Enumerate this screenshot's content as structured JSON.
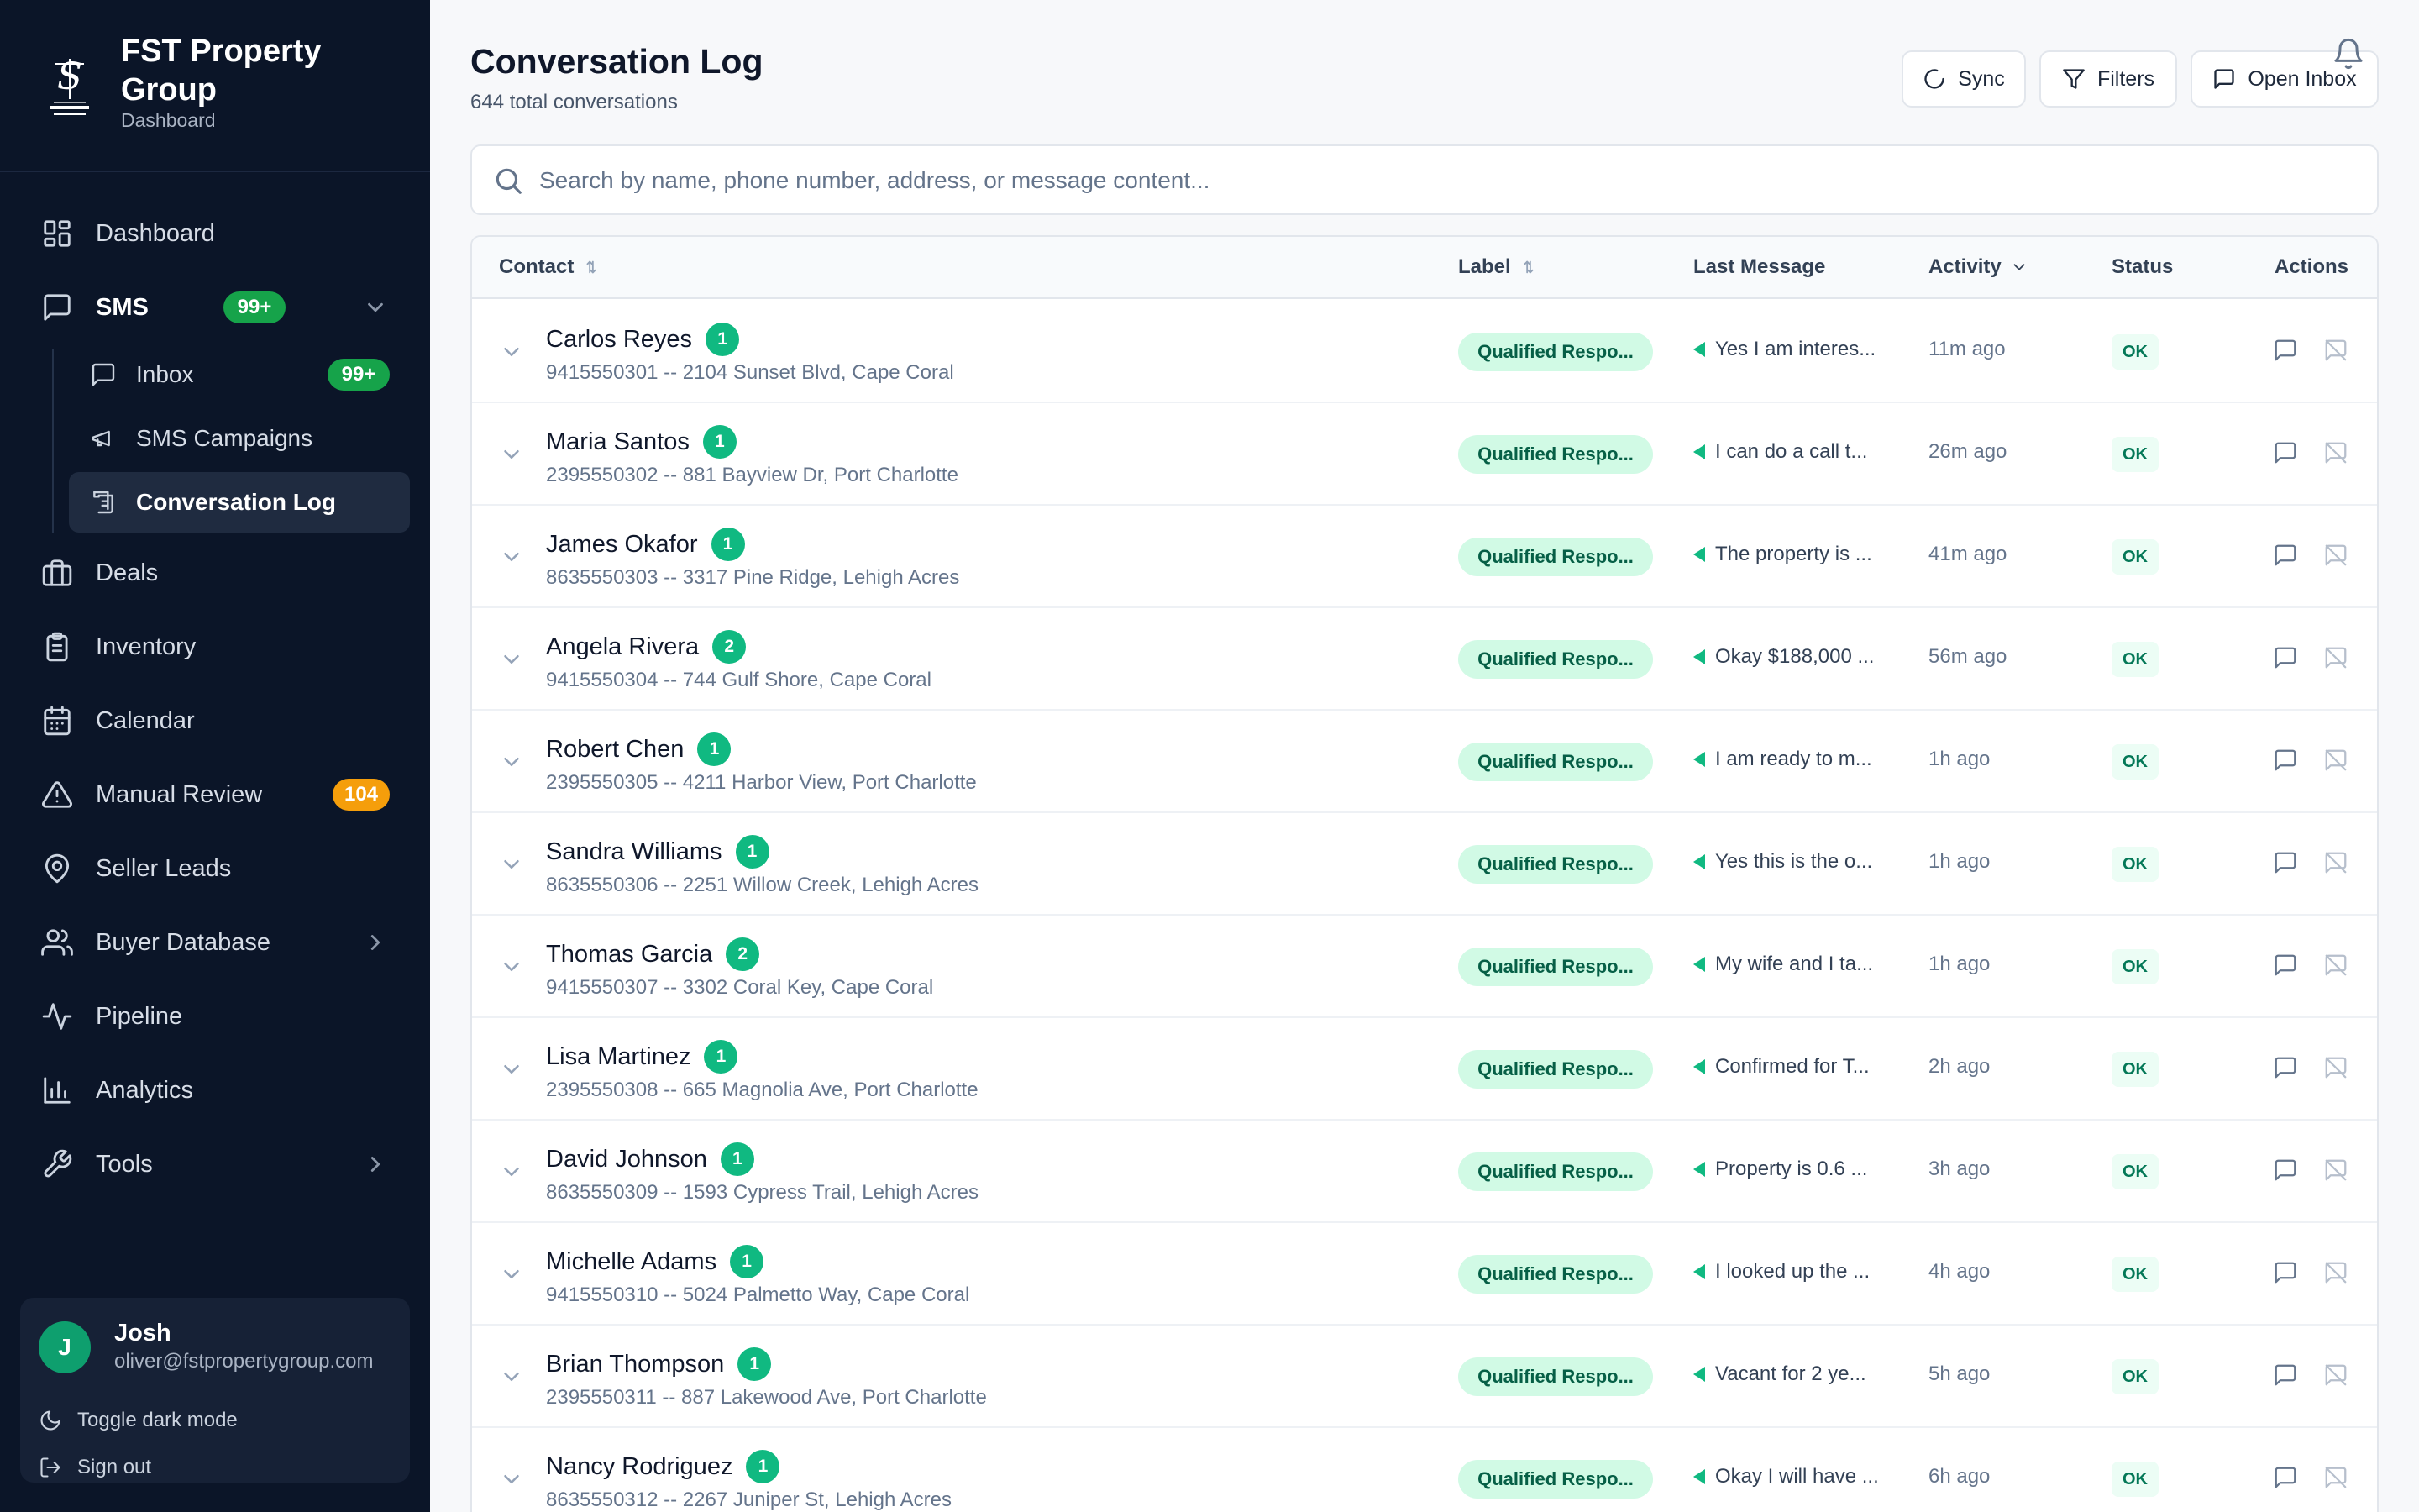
{
  "brand": {
    "name": "FST Property Group",
    "subtitle": "Dashboard"
  },
  "nav": [
    {
      "id": "dashboard",
      "label": "Dashboard",
      "icon": "grid-icon"
    },
    {
      "id": "sms",
      "label": "SMS",
      "icon": "message-square-icon",
      "badge": "99+"
    },
    {
      "id": "deals",
      "label": "Deals",
      "icon": "briefcase-icon"
    },
    {
      "id": "inventory",
      "label": "Inventory",
      "icon": "clipboard-icon"
    },
    {
      "id": "calendar",
      "label": "Calendar",
      "icon": "calendar-icon"
    },
    {
      "id": "manual-review",
      "label": "Manual Review",
      "icon": "alert-triangle-icon",
      "badge": "104"
    },
    {
      "id": "seller-leads",
      "label": "Seller Leads",
      "icon": "map-pin-icon"
    },
    {
      "id": "buyer-database",
      "label": "Buyer Database",
      "icon": "users-icon"
    },
    {
      "id": "pipeline",
      "label": "Pipeline",
      "icon": "activity-icon"
    },
    {
      "id": "analytics",
      "label": "Analytics",
      "icon": "bar-chart-icon"
    },
    {
      "id": "tools",
      "label": "Tools",
      "icon": "wrench-icon"
    }
  ],
  "sms_sub": [
    {
      "label": "Inbox",
      "icon": "message-icon",
      "badge": "99+"
    },
    {
      "label": "SMS Campaigns",
      "icon": "megaphone-icon"
    },
    {
      "label": "Conversation Log",
      "icon": "scroll-icon",
      "active": true
    }
  ],
  "user": {
    "initial": "J",
    "name": "Josh",
    "email": "oliver@fstpropertygroup.com",
    "dark_mode_label": "Toggle dark mode",
    "sign_out_label": "Sign out"
  },
  "header": {
    "title": "Conversation Log",
    "subtitle": "644 total conversations",
    "sync_label": "Sync",
    "filters_label": "Filters",
    "open_inbox_label": "Open Inbox"
  },
  "search": {
    "placeholder": "Search by name, phone number, address, or message content..."
  },
  "table": {
    "columns": {
      "contact": "Contact",
      "label": "Label",
      "last_message": "Last Message",
      "activity": "Activity",
      "status": "Status",
      "actions": "Actions"
    },
    "rows": [
      {
        "name": "Carlos Reyes",
        "count": "1",
        "meta": "9415550301 -- 2104 Sunset Blvd, Cape Coral",
        "label": "Qualified Respo...",
        "message": "Yes I am interes...",
        "activity": "11m ago",
        "status": "OK"
      },
      {
        "name": "Maria Santos",
        "count": "1",
        "meta": "2395550302 -- 881 Bayview Dr, Port Charlotte",
        "label": "Qualified Respo...",
        "message": "I can do a call t...",
        "activity": "26m ago",
        "status": "OK"
      },
      {
        "name": "James Okafor",
        "count": "1",
        "meta": "8635550303 -- 3317 Pine Ridge, Lehigh Acres",
        "label": "Qualified Respo...",
        "message": "The property is ...",
        "activity": "41m ago",
        "status": "OK"
      },
      {
        "name": "Angela Rivera",
        "count": "2",
        "meta": "9415550304 -- 744 Gulf Shore, Cape Coral",
        "label": "Qualified Respo...",
        "message": "Okay $188,000 ...",
        "activity": "56m ago",
        "status": "OK"
      },
      {
        "name": "Robert Chen",
        "count": "1",
        "meta": "2395550305 -- 4211 Harbor View, Port Charlotte",
        "label": "Qualified Respo...",
        "message": "I am ready to m...",
        "activity": "1h ago",
        "status": "OK"
      },
      {
        "name": "Sandra Williams",
        "count": "1",
        "meta": "8635550306 -- 2251 Willow Creek, Lehigh Acres",
        "label": "Qualified Respo...",
        "message": "Yes this is the o...",
        "activity": "1h ago",
        "status": "OK"
      },
      {
        "name": "Thomas Garcia",
        "count": "2",
        "meta": "9415550307 -- 3302 Coral Key, Cape Coral",
        "label": "Qualified Respo...",
        "message": "My wife and I ta...",
        "activity": "1h ago",
        "status": "OK"
      },
      {
        "name": "Lisa Martinez",
        "count": "1",
        "meta": "2395550308 -- 665 Magnolia Ave, Port Charlotte",
        "label": "Qualified Respo...",
        "message": "Confirmed for T...",
        "activity": "2h ago",
        "status": "OK"
      },
      {
        "name": "David Johnson",
        "count": "1",
        "meta": "8635550309 -- 1593 Cypress Trail, Lehigh Acres",
        "label": "Qualified Respo...",
        "message": "Property is 0.6 ...",
        "activity": "3h ago",
        "status": "OK"
      },
      {
        "name": "Michelle Adams",
        "count": "1",
        "meta": "9415550310 -- 5024 Palmetto Way, Cape Coral",
        "label": "Qualified Respo...",
        "message": "I looked up the ...",
        "activity": "4h ago",
        "status": "OK"
      },
      {
        "name": "Brian Thompson",
        "count": "1",
        "meta": "2395550311 -- 887 Lakewood Ave, Port Charlotte",
        "label": "Qualified Respo...",
        "message": "Vacant for 2 ye...",
        "activity": "5h ago",
        "status": "OK"
      },
      {
        "name": "Nancy Rodriguez",
        "count": "1",
        "meta": "8635550312 -- 2267 Juniper St, Lehigh Acres",
        "label": "Qualified Respo...",
        "message": "Okay I will have ...",
        "activity": "6h ago",
        "status": "OK"
      }
    ]
  },
  "colors": {
    "sidebar_bg": "#0b1528",
    "accent_green": "#10b981",
    "badge_green": "#16a34a",
    "badge_orange": "#f59e0b",
    "label_bg": "#d1fae5"
  }
}
